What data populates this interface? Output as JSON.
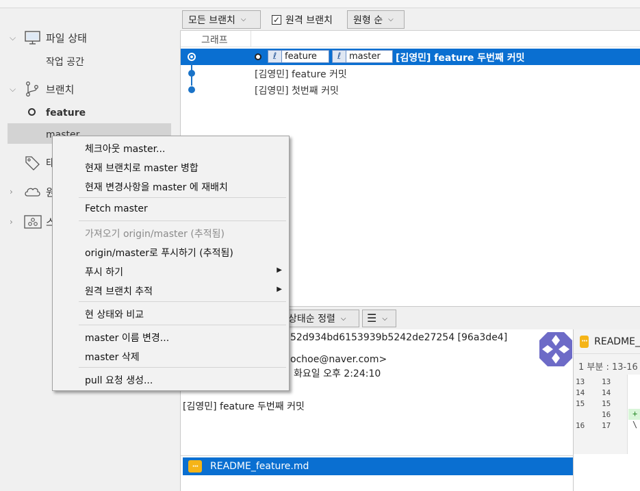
{
  "sidebar": {
    "file_status": {
      "label": "파일 상태",
      "children": [
        "작업 공간"
      ]
    },
    "branches": {
      "label": "브랜치",
      "items": [
        {
          "name": "feature",
          "current": true
        },
        {
          "name": "master",
          "current": false
        }
      ]
    },
    "tags_partial": "태",
    "remotes_partial": "원",
    "stashes_partial": "스"
  },
  "toolbar": {
    "branch_filter": "모든 브랜치",
    "remote_branches_label": "원격 브랜치",
    "remote_branches_checked": true,
    "order": "원형 순"
  },
  "commit_list": {
    "graph_header": "그래프",
    "commits": [
      {
        "message": "[김영민] feature 두번째 커밋",
        "tags": [
          "feature",
          "master"
        ],
        "selected": true
      },
      {
        "message": "[김영민] feature 커밋",
        "tags": [],
        "selected": false
      },
      {
        "message": "[김영민] 첫번째 커밋",
        "tags": [],
        "selected": false
      }
    ]
  },
  "lower_toolbar": {
    "sort_label": "상태순 정렬"
  },
  "detail": {
    "hash_line": "52d934bd6153939b5242de27254 [96a3de4]",
    "email_line": "ochoe@naver.com>",
    "date_line": "화요일 오후 2:24:10",
    "message": "[김영민] feature 두번째 커밋"
  },
  "files": [
    {
      "name": "README_feature.md",
      "selected": true
    }
  ],
  "diff": {
    "file_header": "README_",
    "hunk": "1 부분 : 13-16",
    "lines": [
      {
        "old": "13",
        "new": "13"
      },
      {
        "old": "14",
        "new": "14"
      },
      {
        "old": "15",
        "new": "15"
      },
      {
        "old": "",
        "new": "16"
      },
      {
        "old": "16",
        "new": "17"
      }
    ],
    "add_marker": "+",
    "noeol_marker": "\\"
  },
  "context_menu": {
    "items": [
      {
        "label": "체크아웃 master...",
        "enabled": true
      },
      {
        "label": "현재 브랜치로 master 병합",
        "enabled": true
      },
      {
        "label": "현재 변경사항을 master 에 재배치",
        "enabled": true
      },
      {
        "label": "Fetch master",
        "enabled": true
      },
      {
        "label": "가져오기 origin/master (추적됨)",
        "enabled": false
      },
      {
        "label": "origin/master로 푸시하기 (추적됨)",
        "enabled": true
      },
      {
        "label": "푸시 하기",
        "enabled": true,
        "submenu": true
      },
      {
        "label": "원격 브랜치 추적",
        "enabled": true,
        "submenu": true
      },
      {
        "label": "현 상태와 비교",
        "enabled": true
      },
      {
        "label": "master 이름 변경...",
        "enabled": true
      },
      {
        "label": "master 삭제",
        "enabled": true
      },
      {
        "label": "pull 요청 생성...",
        "enabled": true
      }
    ]
  },
  "colors": {
    "selection": "#0a6fd1",
    "graph_node": "#1a73c8",
    "avatar": "#6d6bc7"
  }
}
